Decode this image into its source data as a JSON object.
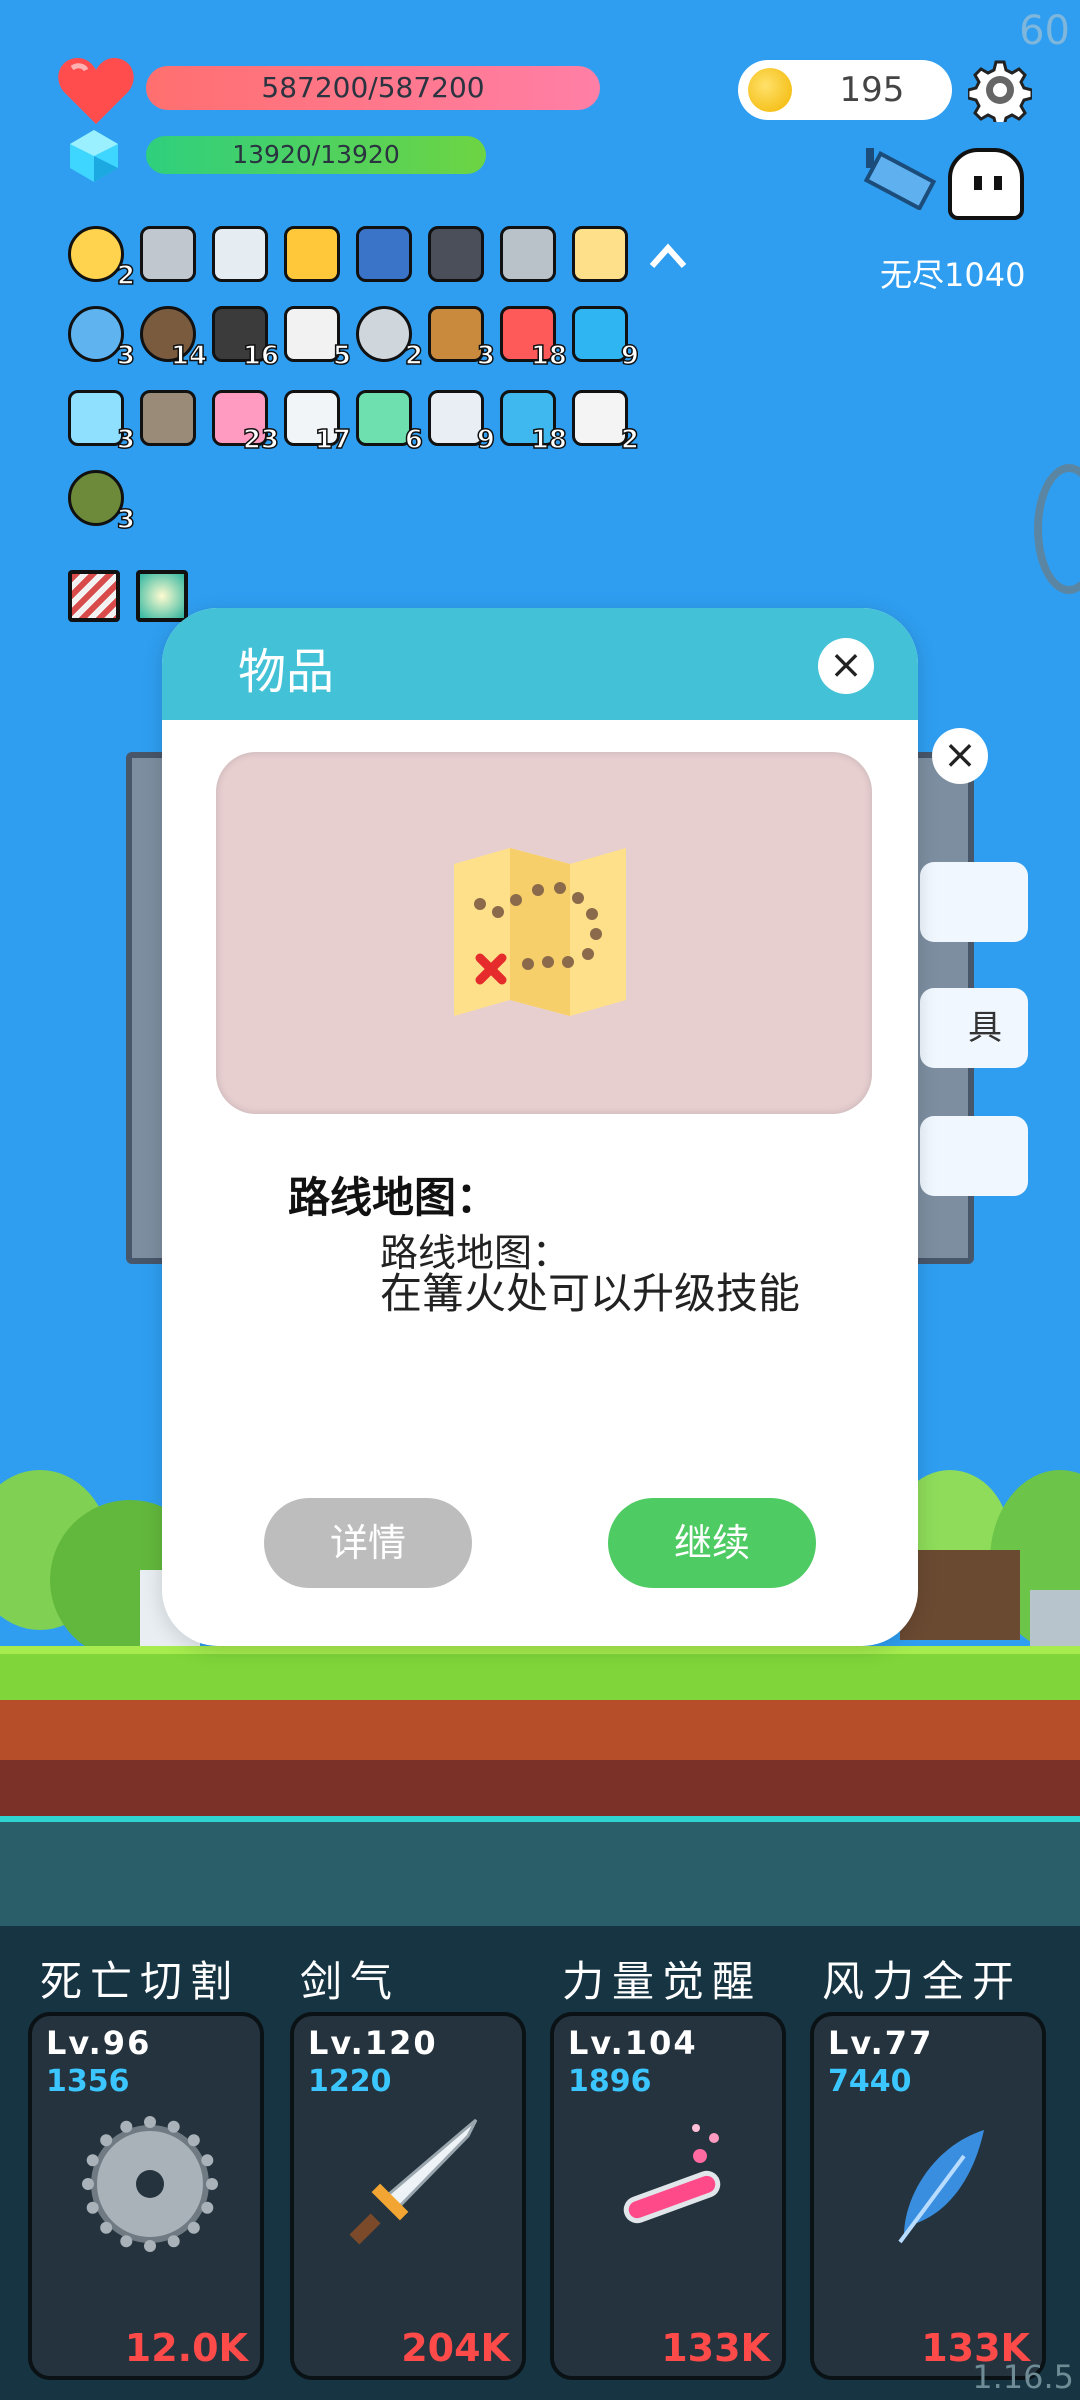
{
  "fps": "60",
  "version": "1.16.5",
  "hud": {
    "hp": "587200/587200",
    "mp": "13920/13920",
    "coins": "195",
    "mode": "无尽1040"
  },
  "inventory": {
    "row1": [
      {
        "icon": "sun-icon",
        "count": "2"
      },
      {
        "icon": "mace-icon",
        "count": ""
      },
      {
        "icon": "sword-icon",
        "count": ""
      },
      {
        "icon": "crown-icon",
        "count": ""
      },
      {
        "icon": "tarot-cards-icon",
        "count": ""
      },
      {
        "icon": "skull-book-icon",
        "count": ""
      },
      {
        "icon": "viking-helmet-icon",
        "count": ""
      },
      {
        "icon": "treasure-map-icon",
        "count": ""
      }
    ],
    "row2": [
      {
        "icon": "target-icon",
        "count": "3"
      },
      {
        "icon": "coconut-icon",
        "count": "14"
      },
      {
        "icon": "cauldron-icon",
        "count": "16"
      },
      {
        "icon": "playing-cards-icon",
        "count": "5"
      },
      {
        "icon": "compass-icon",
        "count": "2"
      },
      {
        "icon": "bow-icon",
        "count": "3"
      },
      {
        "icon": "watermelon-icon",
        "count": "18"
      },
      {
        "icon": "sapphire-icon",
        "count": "9"
      }
    ],
    "row3": [
      {
        "icon": "potion-flask-icon",
        "count": "3"
      },
      {
        "icon": "meteor-icon",
        "count": ""
      },
      {
        "icon": "ice-cream-icon",
        "count": "23"
      },
      {
        "icon": "cloud-icon",
        "count": "17"
      },
      {
        "icon": "ghost-lamp-icon",
        "count": "6"
      },
      {
        "icon": "lightbulb-icon",
        "count": "9"
      },
      {
        "icon": "speech-bubble-icon",
        "count": "18"
      },
      {
        "icon": "dice-icon",
        "count": "2"
      }
    ],
    "row4": [
      {
        "icon": "grenade-icon",
        "count": "3"
      }
    ],
    "buffs": [
      "striped-buff-icon",
      "light-buff-icon"
    ]
  },
  "background_panel": {
    "side_button_2": "具"
  },
  "modal": {
    "title": "物品",
    "item_name": "路线地图：",
    "desc_line1": "路线地图：",
    "desc_line2": "在篝火处可以升级技能",
    "details_label": "详情",
    "continue_label": "继续"
  },
  "skills": [
    {
      "name": "死亡切割",
      "level": "Lv.96",
      "cost": "1356",
      "damage": "12.0K",
      "icon": "saw-blade-icon"
    },
    {
      "name": "剑气",
      "level": "Lv.120",
      "cost": "1220",
      "damage": "204K",
      "icon": "sword-icon"
    },
    {
      "name": "力量觉醒",
      "level": "Lv.104",
      "cost": "1896",
      "damage": "133K",
      "icon": "test-tube-icon"
    },
    {
      "name": "风力全开",
      "level": "Lv.77",
      "cost": "7440",
      "damage": "133K",
      "icon": "feather-icon"
    }
  ],
  "colors": {
    "sky": "#2f9ef0",
    "modal_header": "#43c2d7",
    "continue_button": "#4fcb64",
    "details_button": "#bdbdbd",
    "damage_text": "#ff4a4a",
    "cost_text": "#3cc6ff"
  }
}
